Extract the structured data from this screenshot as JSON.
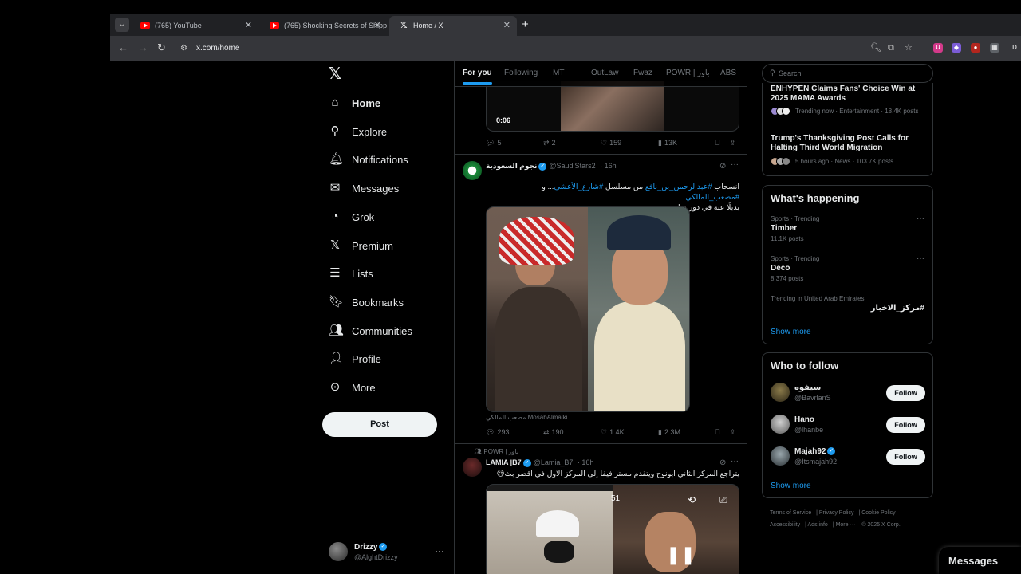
{
  "browser": {
    "tabs": [
      {
        "title": "(765) YouTube",
        "icon": "youtube-icon"
      },
      {
        "title": "(765) Shocking Secrets of Shipp",
        "icon": "youtube-icon"
      },
      {
        "title": "Home / X",
        "icon": "x-logo-icon"
      }
    ],
    "url": "x.com/home"
  },
  "nav": {
    "items": [
      {
        "label": "Home",
        "icon": "home-icon"
      },
      {
        "label": "Explore",
        "icon": "search-icon"
      },
      {
        "label": "Notifications",
        "icon": "bell-icon"
      },
      {
        "label": "Messages",
        "icon": "envelope-icon"
      },
      {
        "label": "Grok",
        "icon": "grok-icon"
      },
      {
        "label": "Premium",
        "icon": "x-logo-icon"
      },
      {
        "label": "Lists",
        "icon": "list-icon"
      },
      {
        "label": "Bookmarks",
        "icon": "bookmark-icon"
      },
      {
        "label": "Communities",
        "icon": "people-icon"
      },
      {
        "label": "Profile",
        "icon": "person-icon"
      },
      {
        "label": "More",
        "icon": "more-circle-icon"
      }
    ],
    "post_label": "Post",
    "account": {
      "name": "Drizzy",
      "handle": "@AlghtDrizzy"
    }
  },
  "timeline": {
    "tabs": [
      "For you",
      "Following",
      "MT",
      "OutLaw",
      "Fwaz",
      "POWR | باور",
      "ABS"
    ],
    "top_video": {
      "time": "0:06",
      "stats": {
        "replies": "5",
        "reposts": "2",
        "likes": "159",
        "views": "13K"
      }
    },
    "tweet1": {
      "name": "نجوم السعودية",
      "handle": "@SaudiStars2",
      "time": "· 16h",
      "text_l1_plain_a": "انسحاب ",
      "text_l1_tag_a": "#عبدالرحمن_بن_نافع",
      "text_l1_plain_b": " من مسلسل ",
      "text_l1_tag_b": "#شارع_الأعشى",
      "text_l1_plain_c": "... و ",
      "text_l1_tag_c": "#مصعب_المالكي",
      "text_l2": "بديلًا عنه في دور ضاري.",
      "media_caption": "مصعب المالكي MosabAlmalki",
      "stats": {
        "replies": "293",
        "reposts": "190",
        "likes": "1.4K",
        "views": "2.3M"
      }
    },
    "tweet2": {
      "context": "POWR | باور",
      "name": "LAMIA |B7",
      "handle": "@Lamia_B7",
      "time": "· 16h",
      "text": "يتراجع المركز الثاني ابونوح ويتقدم مستر فيفا إلى المركز الاول في اقصر بث😢",
      "video_number": "51"
    }
  },
  "sidebar": {
    "search_placeholder": "Search",
    "news": [
      {
        "title": "ENHYPEN Claims Fans' Choice Win at 2025 MAMA Awards",
        "meta": "Trending now · Entertainment · 18.4K posts"
      },
      {
        "title": "Trump's Thanksgiving Post Calls for Halting Third World Migration",
        "meta": "5 hours ago · News · 103.7K posts"
      }
    ],
    "whats_happening": {
      "title": "What's happening",
      "trends": [
        {
          "context": "Sports · Trending",
          "name": "Timber",
          "count": "11.1K posts"
        },
        {
          "context": "Sports · Trending",
          "name": "Deco",
          "count": "8,374 posts"
        },
        {
          "context": "Trending in United Arab Emirates",
          "name": "#مركز_الاخبار",
          "count": ""
        }
      ],
      "show_more": "Show more"
    },
    "who_to_follow": {
      "title": "Who to follow",
      "users": [
        {
          "name": "سيفوه",
          "handle": "@BavrlanS"
        },
        {
          "name": "Hano",
          "handle": "@lhanbe"
        },
        {
          "name": "Majah92",
          "handle": "@Itsmajah92"
        }
      ],
      "follow_label": "Follow",
      "show_more": "Show more"
    },
    "footer": [
      "Terms of Service",
      "Privacy Policy",
      "Cookie Policy",
      "Accessibility",
      "Ads info",
      "More ···",
      "© 2025 X Corp."
    ]
  },
  "messages_drawer": {
    "label": "Messages"
  },
  "colors": {
    "accent": "#1d9bf0",
    "background": "#000000",
    "border": "#2f3336",
    "muted": "#71767b"
  }
}
